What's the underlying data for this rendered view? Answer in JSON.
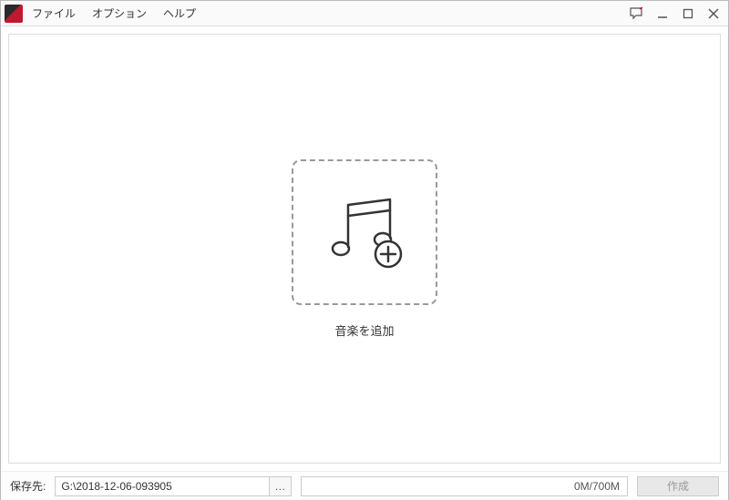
{
  "menu": {
    "file": "ファイル",
    "options": "オプション",
    "help": "ヘルプ"
  },
  "dropzone": {
    "label": "音楽を追加"
  },
  "footer": {
    "save_label": "保存先:",
    "path": "G:\\2018-12-06-093905",
    "browse": "…",
    "progress_text": "0M/700M",
    "create": "作成"
  }
}
